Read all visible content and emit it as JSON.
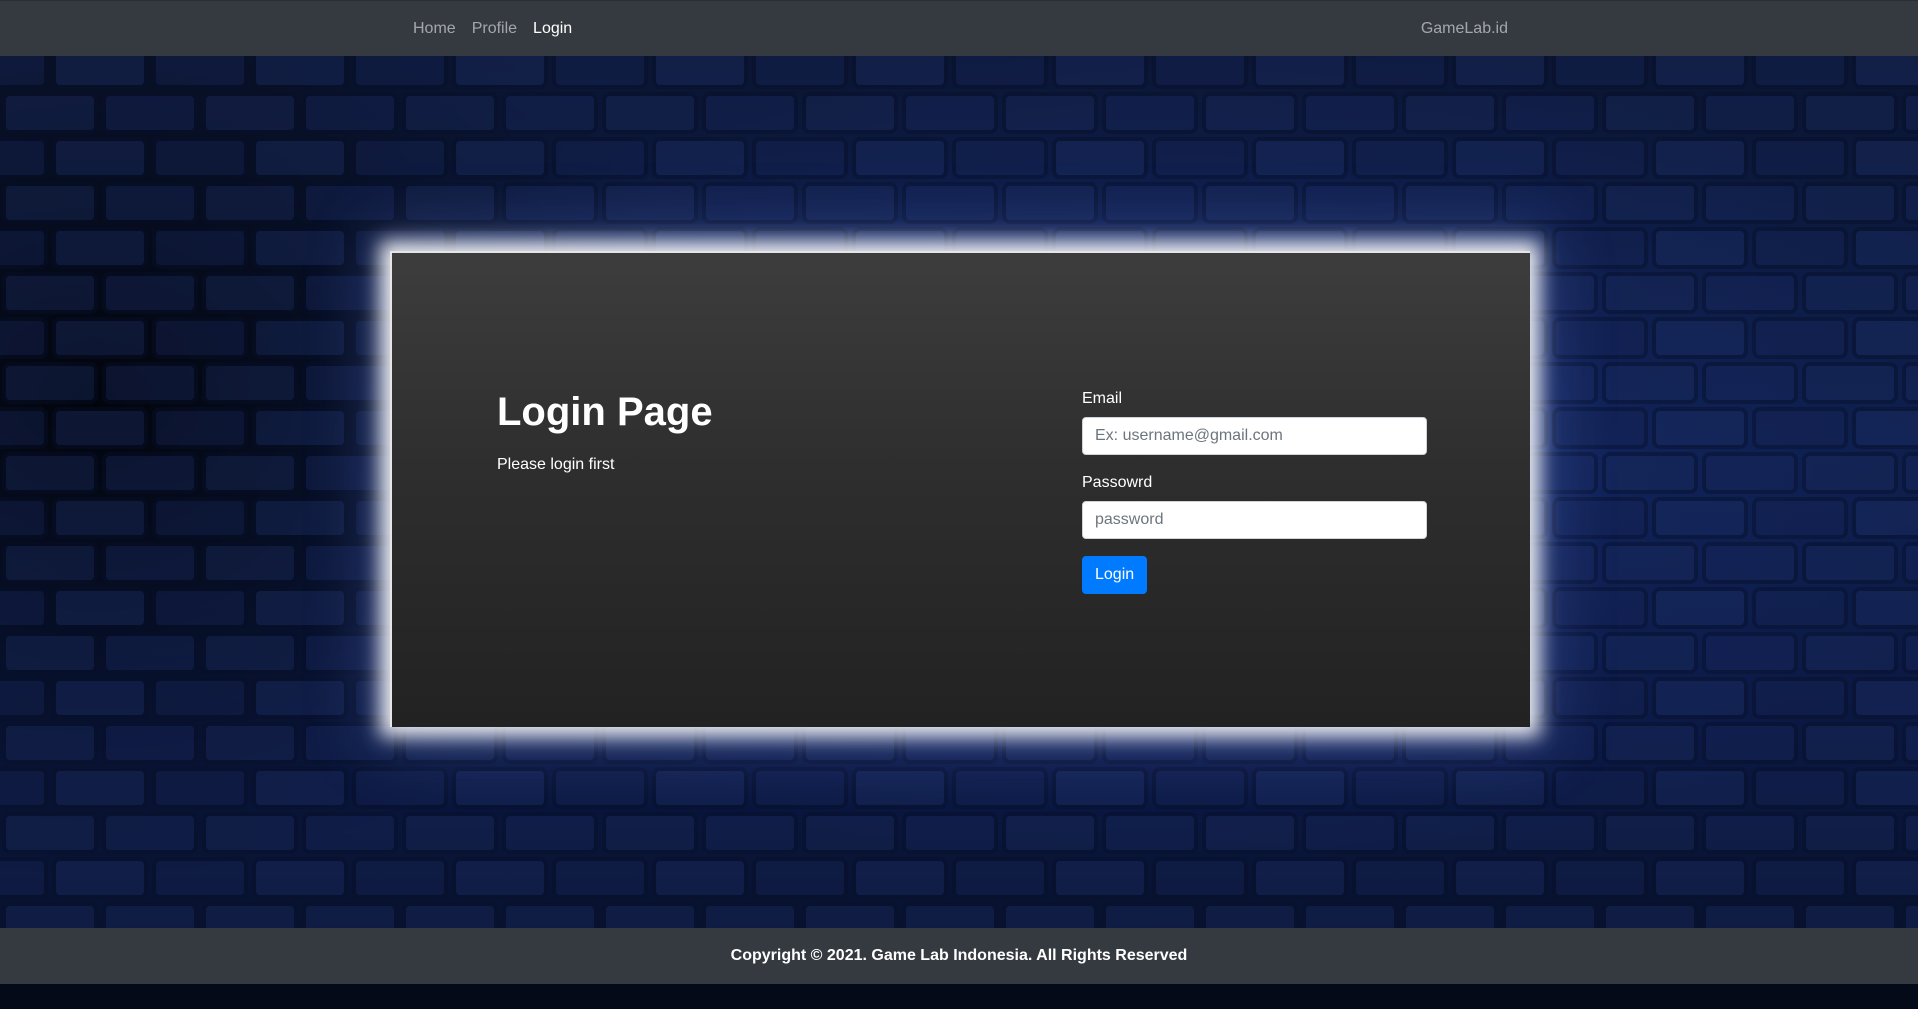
{
  "navbar": {
    "links": [
      {
        "label": "Home"
      },
      {
        "label": "Profile"
      },
      {
        "label": "Login"
      }
    ],
    "active_index": 2,
    "brand": "GameLab.id"
  },
  "login_card": {
    "title": "Login Page",
    "subtitle": "Please login first",
    "email_label": "Email",
    "email_placeholder": "Ex: username@gmail.com",
    "email_value": "",
    "password_label": "Passowrd",
    "password_placeholder": "password",
    "password_value": "",
    "submit_label": "Login"
  },
  "footer": {
    "text": "Copyright © 2021. Game Lab Indonesia. All Rights Reserved"
  },
  "colors": {
    "navbar_bg": "#343a40",
    "accent": "#007bff",
    "card_bg": "#2e2e2e"
  }
}
